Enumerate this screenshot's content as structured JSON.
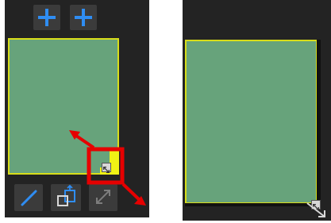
{
  "icons": {
    "add_primary": "plus-icon",
    "add_secondary": "plus-icon",
    "pen": "pen-icon",
    "swap": "swap-icon",
    "expand": "expand-icon",
    "resize": "resize-diagonal-icon"
  },
  "colors": {
    "panel_background": "#232323",
    "button_background": "#3b3b3b",
    "crop_fill": "#67a37b",
    "crop_border": "#d8dd1a",
    "highlight": "#f0f215",
    "annotation_red": "#e60000",
    "accent_blue": "#2f8df2"
  }
}
